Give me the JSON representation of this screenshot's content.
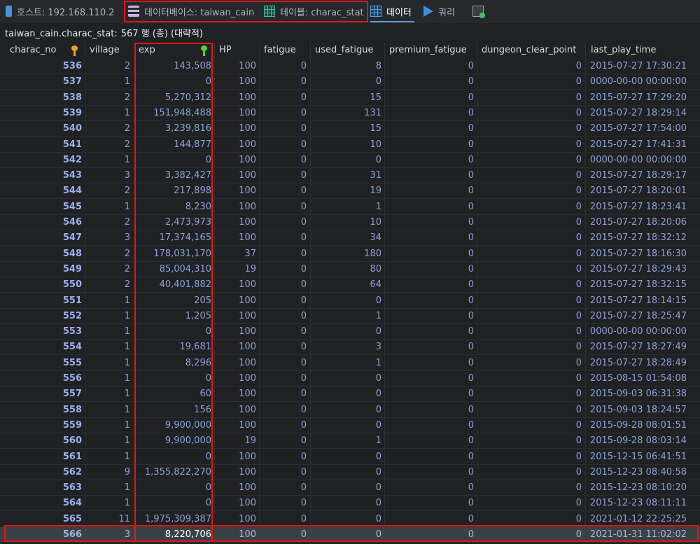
{
  "tabs": {
    "host": "호스트: 192.168.110.2",
    "database": "데이터베이스: taiwan_cain",
    "table": "테이블: charac_stat",
    "data": "데이터",
    "query": "쿼리"
  },
  "info": {
    "table_path": "taiwan_cain.charac_stat:",
    "row_count": "567 행 (총) (대략적)"
  },
  "columns": [
    "charac_no",
    "village",
    "exp",
    "HP",
    "fatigue",
    "used_fatigue",
    "premium_fatigue",
    "dungeon_clear_point",
    "last_play_time"
  ],
  "rows": [
    [
      "536",
      "2",
      "143,508",
      "100",
      "0",
      "8",
      "0",
      "0",
      "2015-07-27 17:30:21"
    ],
    [
      "537",
      "1",
      "0",
      "100",
      "0",
      "0",
      "0",
      "0",
      "0000-00-00 00:00:00"
    ],
    [
      "538",
      "2",
      "5,270,312",
      "100",
      "0",
      "15",
      "0",
      "0",
      "2015-07-27 17:29:20"
    ],
    [
      "539",
      "1",
      "151,948,488",
      "100",
      "0",
      "131",
      "0",
      "0",
      "2015-07-27 18:29:14"
    ],
    [
      "540",
      "2",
      "3,239,816",
      "100",
      "0",
      "15",
      "0",
      "0",
      "2015-07-27 17:54:00"
    ],
    [
      "541",
      "2",
      "144,877",
      "100",
      "0",
      "10",
      "0",
      "0",
      "2015-07-27 17:41:31"
    ],
    [
      "542",
      "1",
      "0",
      "100",
      "0",
      "0",
      "0",
      "0",
      "0000-00-00 00:00:00"
    ],
    [
      "543",
      "3",
      "3,382,427",
      "100",
      "0",
      "31",
      "0",
      "0",
      "2015-07-27 18:29:17"
    ],
    [
      "544",
      "2",
      "217,898",
      "100",
      "0",
      "19",
      "0",
      "0",
      "2015-07-27 18:20:01"
    ],
    [
      "545",
      "1",
      "8,230",
      "100",
      "0",
      "1",
      "0",
      "0",
      "2015-07-27 18:23:41"
    ],
    [
      "546",
      "2",
      "2,473,973",
      "100",
      "0",
      "10",
      "0",
      "0",
      "2015-07-27 18:20:06"
    ],
    [
      "547",
      "3",
      "17,374,165",
      "100",
      "0",
      "34",
      "0",
      "0",
      "2015-07-27 18:32:12"
    ],
    [
      "548",
      "2",
      "178,031,170",
      "37",
      "0",
      "180",
      "0",
      "0",
      "2015-07-27 18:16:30"
    ],
    [
      "549",
      "2",
      "85,004,310",
      "19",
      "0",
      "80",
      "0",
      "0",
      "2015-07-27 18:29:43"
    ],
    [
      "550",
      "2",
      "40,401,882",
      "100",
      "0",
      "64",
      "0",
      "0",
      "2015-07-27 18:32:15"
    ],
    [
      "551",
      "1",
      "205",
      "100",
      "0",
      "0",
      "0",
      "0",
      "2015-07-27 18:14:15"
    ],
    [
      "552",
      "1",
      "1,205",
      "100",
      "0",
      "1",
      "0",
      "0",
      "2015-07-27 18:25:47"
    ],
    [
      "553",
      "1",
      "0",
      "100",
      "0",
      "0",
      "0",
      "0",
      "0000-00-00 00:00:00"
    ],
    [
      "554",
      "1",
      "19,681",
      "100",
      "0",
      "3",
      "0",
      "0",
      "2015-07-27 18:27:49"
    ],
    [
      "555",
      "1",
      "8,296",
      "100",
      "0",
      "1",
      "0",
      "0",
      "2015-07-27 18:28:49"
    ],
    [
      "556",
      "1",
      "0",
      "100",
      "0",
      "0",
      "0",
      "0",
      "2015-08-15 01:54:08"
    ],
    [
      "557",
      "1",
      "60",
      "100",
      "0",
      "0",
      "0",
      "0",
      "2015-09-03 06:31:38"
    ],
    [
      "558",
      "1",
      "156",
      "100",
      "0",
      "0",
      "0",
      "0",
      "2015-09-03 18:24:57"
    ],
    [
      "559",
      "1",
      "9,900,000",
      "100",
      "0",
      "0",
      "0",
      "0",
      "2015-09-28 08:01:51"
    ],
    [
      "560",
      "1",
      "9,900,000",
      "19",
      "0",
      "1",
      "0",
      "0",
      "2015-09-28 08:03:14"
    ],
    [
      "561",
      "1",
      "0",
      "100",
      "0",
      "0",
      "0",
      "0",
      "2015-12-15 06:41:51"
    ],
    [
      "562",
      "9",
      "1,355,822,270",
      "100",
      "0",
      "0",
      "0",
      "0",
      "2015-12-23 08:40:58"
    ],
    [
      "563",
      "1",
      "0",
      "100",
      "0",
      "0",
      "0",
      "0",
      "2015-12-23 08:10:20"
    ],
    [
      "564",
      "1",
      "0",
      "100",
      "0",
      "0",
      "0",
      "0",
      "2015-12-23 08:11:11"
    ],
    [
      "565",
      "11",
      "1,975,309,387",
      "100",
      "0",
      "0",
      "0",
      "0",
      "2021-01-12 22:25:25"
    ],
    [
      "566",
      "3",
      "8,220,706",
      "100",
      "0",
      "0",
      "0",
      "0",
      "2021-01-31 11:02:02"
    ]
  ],
  "selected_row": "566",
  "icons": {
    "charac_no": "primary-key-icon",
    "exp": "index-key-icon"
  },
  "colors": {
    "background": "#1f2123",
    "highlight_box": "#e01818",
    "number": "#8fa0d8",
    "datetime": "#d57a6a"
  }
}
